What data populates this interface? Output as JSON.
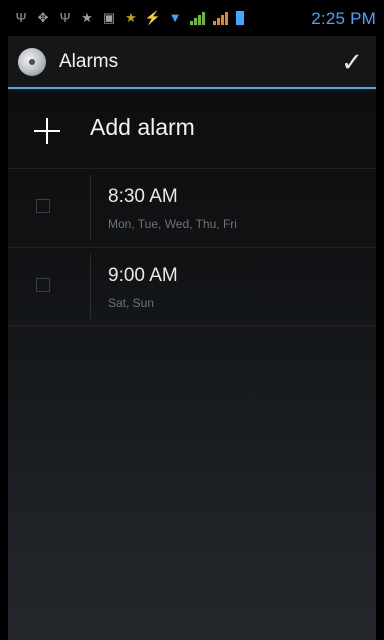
{
  "status_bar": {
    "time": "2:25 PM",
    "icons": [
      "usb-icon",
      "android-debug-icon",
      "usb-icon",
      "notification-star-icon",
      "image-icon",
      "star-icon",
      "no-vibrate-icon",
      "wifi-icon",
      "signal-icon",
      "signal-icon",
      "battery-icon"
    ]
  },
  "action_bar": {
    "title": "Alarms",
    "done_icon": "check-icon"
  },
  "add_alarm": {
    "label": "Add alarm",
    "icon": "plus-icon"
  },
  "alarms": [
    {
      "time": "8:30 AM",
      "days": "Mon, Tue, Wed, Thu, Fri",
      "enabled": false
    },
    {
      "time": "9:00 AM",
      "days": "Sat, Sun",
      "enabled": false
    }
  ],
  "colors": {
    "accent": "#33b5e5",
    "status_time": "#3fa9ff"
  }
}
